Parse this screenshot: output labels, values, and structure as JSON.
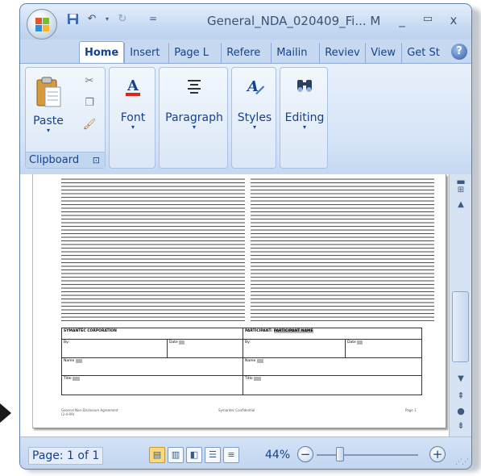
{
  "window": {
    "title": "General_NDA_020409_Fi... M",
    "minimize": "_",
    "restore": "▭",
    "close": "x"
  },
  "quick_access": {
    "save_icon": "save-icon",
    "undo_icon": "undo-icon",
    "redo_icon": "redo-icon",
    "customize": "="
  },
  "tabs": [
    {
      "label": "Home",
      "active": true
    },
    {
      "label": "Insert"
    },
    {
      "label": "Page L"
    },
    {
      "label": "Refere"
    },
    {
      "label": "Mailin"
    },
    {
      "label": "Reviev"
    },
    {
      "label": "View"
    },
    {
      "label": "Get St"
    }
  ],
  "help": "?",
  "ribbon": {
    "clipboard": {
      "paste": "Paste",
      "group_label": "Clipboard",
      "launcher": "⊡"
    },
    "font": {
      "label": "Font"
    },
    "paragraph": {
      "label": "Paragraph"
    },
    "styles": {
      "label": "Styles"
    },
    "editing": {
      "label": "Editing"
    }
  },
  "document": {
    "sig_left_header": "SYMANTEC CORPORATION",
    "sig_right_header": "PARTICIPANT:",
    "sig_right_placeholder": "PARTICIPANT NAME",
    "by": "By:",
    "date": "Date",
    "name": "Name",
    "title_field": "Title",
    "footer_left": "General Non-Disclosure Agreement",
    "footer_left2": "(2-4-09)",
    "footer_center": "Symantec Confidential",
    "footer_right": "Page 1"
  },
  "status": {
    "page": "Page: 1 of 1",
    "zoom": "44%",
    "zoom_out": "−",
    "zoom_in": "+"
  }
}
